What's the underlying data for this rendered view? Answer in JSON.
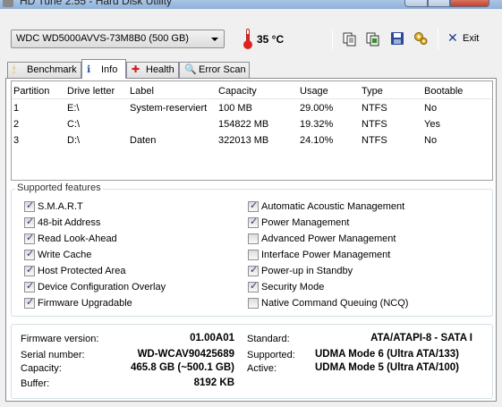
{
  "window": {
    "title": "HD Tune 2.55 - Hard Disk Utility"
  },
  "toolbar": {
    "drive": "WDC WD5000AVVS-73M8B0 (500 GB)",
    "temperature": "35 °C",
    "exit_label": "Exit",
    "icons": [
      "copy-icon",
      "copy-all-icon",
      "save-icon",
      "options-icon"
    ]
  },
  "tabs": [
    {
      "label": "Benchmark",
      "icon": "benchmark-icon",
      "active": false
    },
    {
      "label": "Info",
      "icon": "info-icon",
      "active": true
    },
    {
      "label": "Health",
      "icon": "health-icon",
      "active": false
    },
    {
      "label": "Error Scan",
      "icon": "error-scan-icon",
      "active": false
    }
  ],
  "partitions": {
    "headers": [
      "Partition",
      "Drive letter",
      "Label",
      "Capacity",
      "Usage",
      "Type",
      "Bootable"
    ],
    "rows": [
      [
        "1",
        "E:\\",
        "System-reserviert",
        "100 MB",
        "29.00%",
        "NTFS",
        "No"
      ],
      [
        "2",
        "C:\\",
        "",
        "154822 MB",
        "19.32%",
        "NTFS",
        "Yes"
      ],
      [
        "3",
        "D:\\",
        "Daten",
        "322013 MB",
        "24.10%",
        "NTFS",
        "No"
      ]
    ]
  },
  "features": {
    "title": "Supported features",
    "left": [
      {
        "label": "S.M.A.R.T",
        "checked": true
      },
      {
        "label": "48-bit Address",
        "checked": true
      },
      {
        "label": "Read Look-Ahead",
        "checked": true
      },
      {
        "label": "Write Cache",
        "checked": true
      },
      {
        "label": "Host Protected Area",
        "checked": true
      },
      {
        "label": "Device Configuration Overlay",
        "checked": true
      },
      {
        "label": "Firmware Upgradable",
        "checked": true
      }
    ],
    "right": [
      {
        "label": "Automatic Acoustic Management",
        "checked": true
      },
      {
        "label": "Power Management",
        "checked": true
      },
      {
        "label": "Advanced Power Management",
        "checked": false
      },
      {
        "label": "Interface Power Management",
        "checked": false
      },
      {
        "label": "Power-up in Standby",
        "checked": true
      },
      {
        "label": "Security Mode",
        "checked": true
      },
      {
        "label": "Native Command Queuing (NCQ)",
        "checked": false
      }
    ]
  },
  "info": {
    "firmware_label": "Firmware version:",
    "firmware": "01.00A01",
    "serial_label": "Serial number:",
    "serial": "WD-WCAV90425689",
    "capacity_label": "Capacity:",
    "capacity": "465.8 GB (~500.1 GB)",
    "buffer_label": "Buffer:",
    "buffer": "8192 KB",
    "standard_label": "Standard:",
    "standard": "ATA/ATAPI-8 - SATA I",
    "supported_label": "Supported:",
    "supported": "UDMA Mode 6 (Ultra ATA/133)",
    "active_label": "Active:",
    "active": "UDMA Mode 5 (Ultra ATA/100)"
  }
}
